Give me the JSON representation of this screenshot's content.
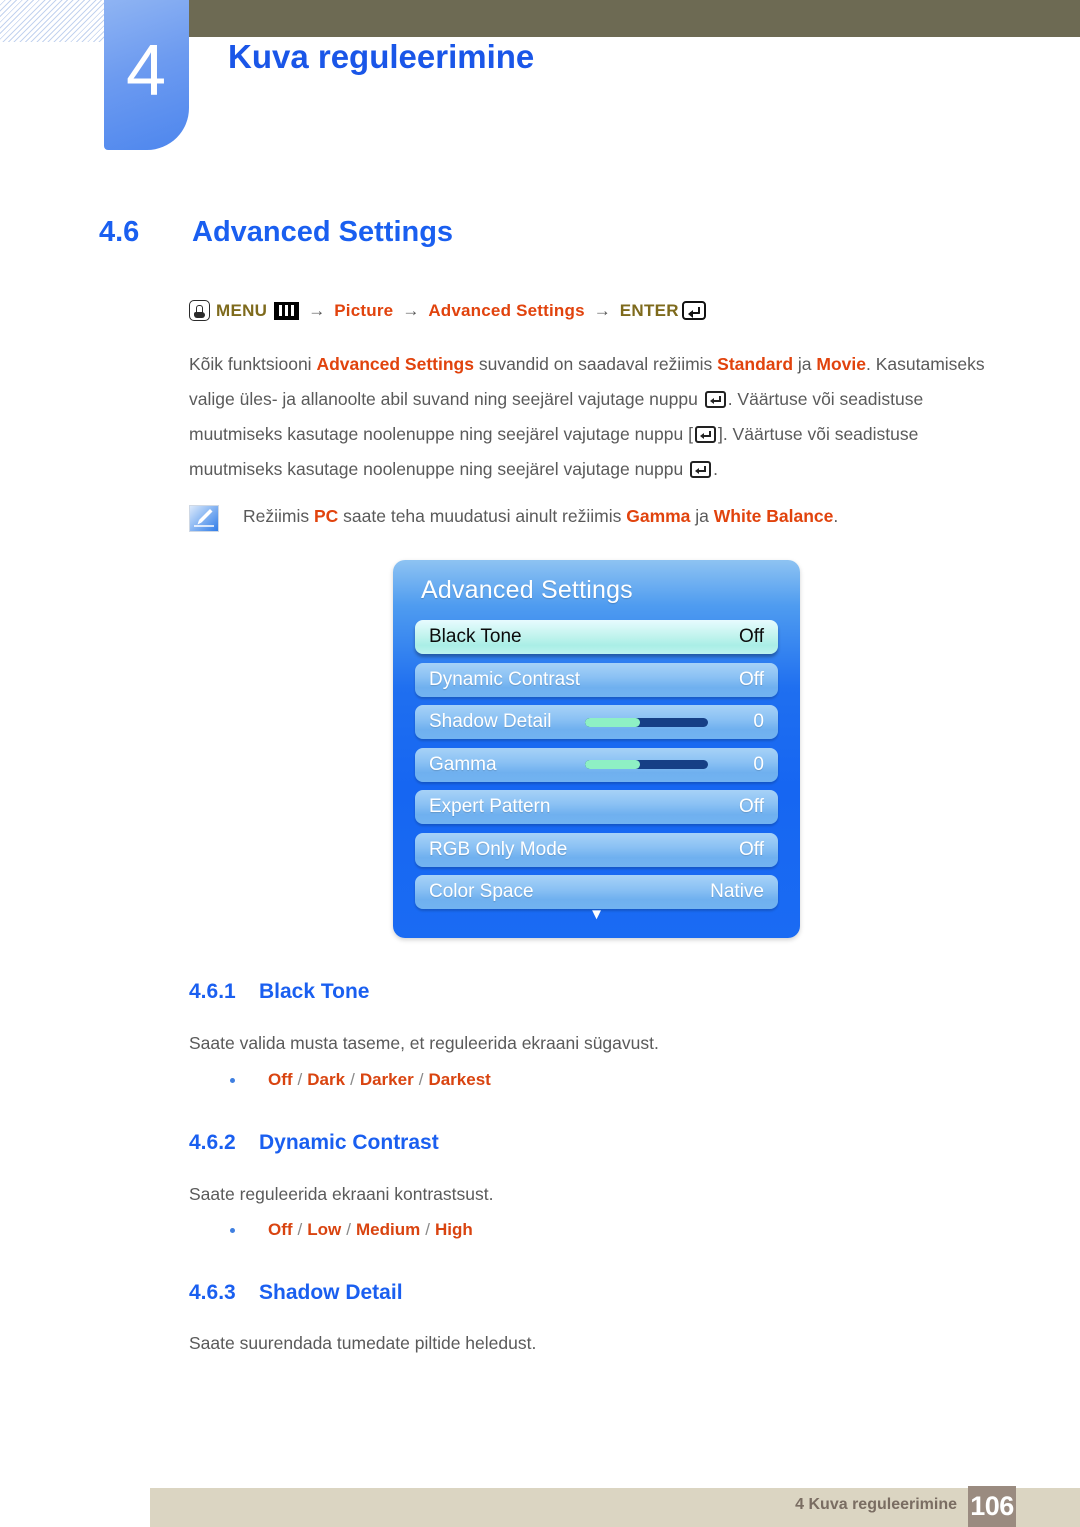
{
  "chapter": {
    "number": "4",
    "title": "Kuva reguleerimine"
  },
  "section": {
    "number": "4.6",
    "title": "Advanced Settings"
  },
  "menu_path": {
    "hand_icon": "hand-press-icon",
    "menu_label": "MENU",
    "menu_bars_icon": "menu-bars-icon",
    "arrow1": "→",
    "picture_label": "Picture",
    "arrow2": "→",
    "advanced_label": "Advanced Settings",
    "arrow3": "→",
    "enter_label": "ENTER",
    "enter_icon": "enter-key-icon"
  },
  "body": {
    "p1_a": "Kõik funktsiooni ",
    "p1_hl1": "Advanced Settings",
    "p1_b": " suvandid on saadaval režiimis ",
    "p1_hl2": "Standard",
    "p1_c": " ja ",
    "p1_hl3": "Movie",
    "p1_d": ". Kasutamiseks valige üles- ja allanoolte abil suvand ning seejärel vajutage nuppu ",
    "p1_e": ". Väärtuse või seadistuse muutmiseks kasutage noolenuppe ning seejärel vajutage nuppu [",
    "p1_f": "]. Väärtuse või seadistuse muutmiseks kasutage noolenuppe ning seejärel vajutage nuppu ",
    "p1_g": "."
  },
  "note": {
    "icon": "note-pen-icon",
    "a": "Režiimis ",
    "hl1": "PC",
    "b": " saate teha muudatusi ainult režiimis ",
    "hl2": "Gamma",
    "c": " ja ",
    "hl3": "White Balance",
    "d": "."
  },
  "osd": {
    "title": "Advanced Settings",
    "caret": "▼",
    "rows": [
      {
        "label": "Black Tone",
        "value": "Off",
        "type": "value",
        "selected": true
      },
      {
        "label": "Dynamic Contrast",
        "value": "Off",
        "type": "value",
        "selected": false
      },
      {
        "label": "Shadow Detail",
        "value": "0",
        "type": "slider",
        "selected": false,
        "fill_percent": 45
      },
      {
        "label": "Gamma",
        "value": "0",
        "type": "slider",
        "selected": false,
        "fill_percent": 45
      },
      {
        "label": "Expert Pattern",
        "value": "Off",
        "type": "value",
        "selected": false
      },
      {
        "label": "RGB Only Mode",
        "value": "Off",
        "type": "value",
        "selected": false
      },
      {
        "label": "Color Space",
        "value": "Native",
        "type": "value",
        "selected": false
      }
    ]
  },
  "subsections": [
    {
      "number": "4.6.1",
      "title": "Black Tone",
      "body": "Saate valida musta taseme, et reguleerida ekraani sügavust.",
      "options": [
        "Off",
        "Dark",
        "Darker",
        "Darkest"
      ]
    },
    {
      "number": "4.6.2",
      "title": "Dynamic Contrast",
      "body": "Saate reguleerida ekraani kontrastsust.",
      "options": [
        "Off",
        "Low",
        "Medium",
        "High"
      ]
    },
    {
      "number": "4.6.3",
      "title": "Shadow Detail",
      "body": "Saate suurendada tumedate piltide heledust.",
      "options": []
    }
  ],
  "footer": {
    "text": "4 Kuva reguleerimine",
    "page": "106"
  },
  "colors": {
    "chapter_blue": "#1a56e8",
    "heading_blue": "#1a5ff0",
    "highlight_orange": "#e1430d",
    "menu_olive": "#7e6a1c",
    "header_olive": "#6d6a53",
    "footer_beige": "#dbd5c2",
    "footer_page_box": "#9a8b80",
    "osd_blue": "#1666f2",
    "osd_row_blue": "#8cc2f4",
    "osd_selected_mint": "#c3f4ee",
    "slider_fill": "#8ef0c4",
    "slider_track": "#163f86"
  }
}
